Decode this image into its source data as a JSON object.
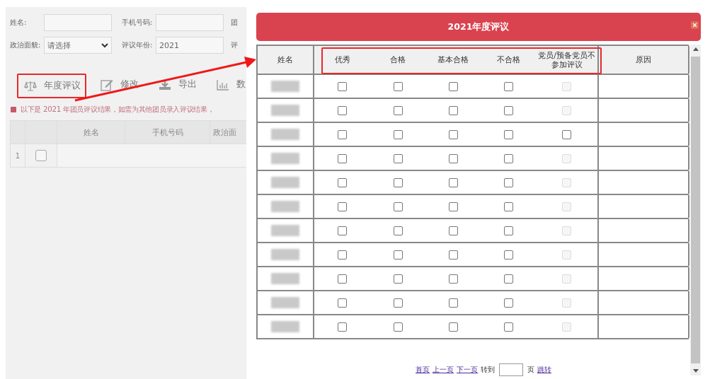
{
  "filters": [
    {
      "label": "姓名:",
      "kind": "text"
    },
    {
      "label": "手机号码:",
      "kind": "text"
    },
    {
      "label": "团",
      "kind": "cut"
    },
    {
      "label": "政治面貌:",
      "kind": "select",
      "value": "请选择"
    },
    {
      "label": "评议年份:",
      "kind": "text",
      "value": "2021"
    },
    {
      "label": "评",
      "kind": "cut"
    }
  ],
  "toolbar": [
    {
      "label": "年度评议",
      "kind": "evaluate",
      "highlighted": true
    },
    {
      "label": "修改",
      "kind": "edit",
      "highlighted": false
    },
    {
      "label": "导出",
      "kind": "export",
      "highlighted": false
    },
    {
      "label": "数",
      "kind": "stats",
      "highlighted": false
    }
  ],
  "notice": "以下是 2021 年团员评议结果，如需为其他团员录入评议结果，",
  "list_table": {
    "columns": [
      "姓名",
      "手机号码",
      "政治面"
    ],
    "rows": [
      {
        "number": "1",
        "checked": false
      }
    ]
  },
  "dialog": {
    "title": "2021年度评议",
    "columns": [
      "姓名",
      "优秀",
      "合格",
      "基本合格",
      "不合格",
      "党员/预备党员不参加评议",
      "原因"
    ],
    "highlight_columns": true,
    "rows": [
      {
        "options": [
          {
            "checked": false,
            "disabled": false
          },
          {
            "checked": false,
            "disabled": false
          },
          {
            "checked": false,
            "disabled": false
          },
          {
            "checked": false,
            "disabled": false
          },
          {
            "checked": false,
            "disabled": true
          }
        ]
      },
      {
        "options": [
          {
            "checked": false,
            "disabled": false
          },
          {
            "checked": false,
            "disabled": false
          },
          {
            "checked": false,
            "disabled": false
          },
          {
            "checked": false,
            "disabled": false
          },
          {
            "checked": false,
            "disabled": true
          }
        ]
      },
      {
        "options": [
          {
            "checked": false,
            "disabled": false
          },
          {
            "checked": false,
            "disabled": false
          },
          {
            "checked": false,
            "disabled": false
          },
          {
            "checked": false,
            "disabled": false
          },
          {
            "checked": false,
            "disabled": false
          }
        ]
      },
      {
        "options": [
          {
            "checked": false,
            "disabled": false
          },
          {
            "checked": false,
            "disabled": false
          },
          {
            "checked": false,
            "disabled": false
          },
          {
            "checked": false,
            "disabled": false
          },
          {
            "checked": false,
            "disabled": true
          }
        ]
      },
      {
        "options": [
          {
            "checked": false,
            "disabled": false
          },
          {
            "checked": false,
            "disabled": false
          },
          {
            "checked": false,
            "disabled": false
          },
          {
            "checked": false,
            "disabled": false
          },
          {
            "checked": false,
            "disabled": true
          }
        ]
      },
      {
        "options": [
          {
            "checked": false,
            "disabled": false
          },
          {
            "checked": false,
            "disabled": false
          },
          {
            "checked": false,
            "disabled": false
          },
          {
            "checked": false,
            "disabled": false
          },
          {
            "checked": false,
            "disabled": true
          }
        ]
      },
      {
        "options": [
          {
            "checked": false,
            "disabled": false
          },
          {
            "checked": false,
            "disabled": false
          },
          {
            "checked": false,
            "disabled": false
          },
          {
            "checked": false,
            "disabled": false
          },
          {
            "checked": false,
            "disabled": true
          }
        ]
      },
      {
        "options": [
          {
            "checked": false,
            "disabled": false
          },
          {
            "checked": false,
            "disabled": false
          },
          {
            "checked": false,
            "disabled": false
          },
          {
            "checked": false,
            "disabled": false
          },
          {
            "checked": false,
            "disabled": true
          }
        ]
      },
      {
        "options": [
          {
            "checked": false,
            "disabled": false
          },
          {
            "checked": false,
            "disabled": false
          },
          {
            "checked": false,
            "disabled": false
          },
          {
            "checked": false,
            "disabled": false
          },
          {
            "checked": false,
            "disabled": true
          }
        ]
      },
      {
        "options": [
          {
            "checked": false,
            "disabled": false
          },
          {
            "checked": false,
            "disabled": false
          },
          {
            "checked": false,
            "disabled": false
          },
          {
            "checked": false,
            "disabled": false
          },
          {
            "checked": false,
            "disabled": true
          }
        ]
      },
      {
        "options": [
          {
            "checked": false,
            "disabled": false
          },
          {
            "checked": false,
            "disabled": false
          },
          {
            "checked": false,
            "disabled": false
          },
          {
            "checked": false,
            "disabled": false
          },
          {
            "checked": false,
            "disabled": true
          }
        ]
      }
    ],
    "pagination": {
      "links": [
        "首页",
        "上一页",
        "下一页"
      ],
      "goto_label": "转到",
      "page_unit": "页",
      "jump": "跳转"
    }
  }
}
